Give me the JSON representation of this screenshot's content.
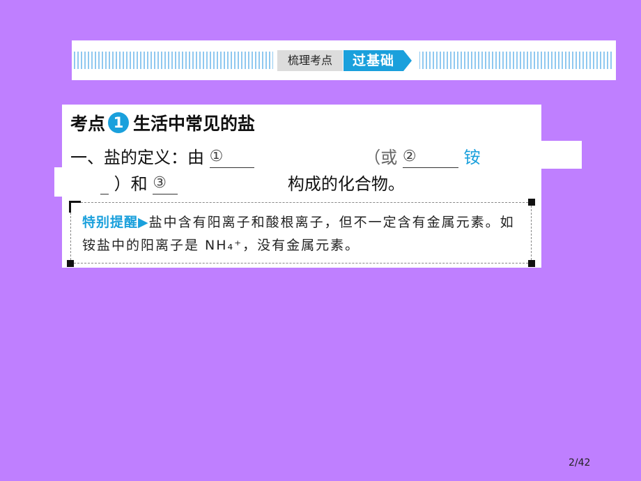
{
  "banner": {
    "left_tag": "梳理考点",
    "right_tag": "过基础"
  },
  "section": {
    "prefix": "考点",
    "number": "1",
    "title": "生活中常见的盐"
  },
  "definition": {
    "heading": "一、盐的定义：由",
    "blank1": "①",
    "open_paren": "（或",
    "blank2": "②",
    "partial_char": "铵",
    "close_and": "）和",
    "blank3": "③",
    "ending": "构成的化合物。"
  },
  "tip": {
    "label": "特别提醒",
    "marker": "▶",
    "text": "盐中含有阳离子和酸根离子，但不一定含有金属元素。如铵盐中的阳离子是 NH₄⁺，没有金属元素。"
  },
  "footer": {
    "page": "2/42"
  }
}
